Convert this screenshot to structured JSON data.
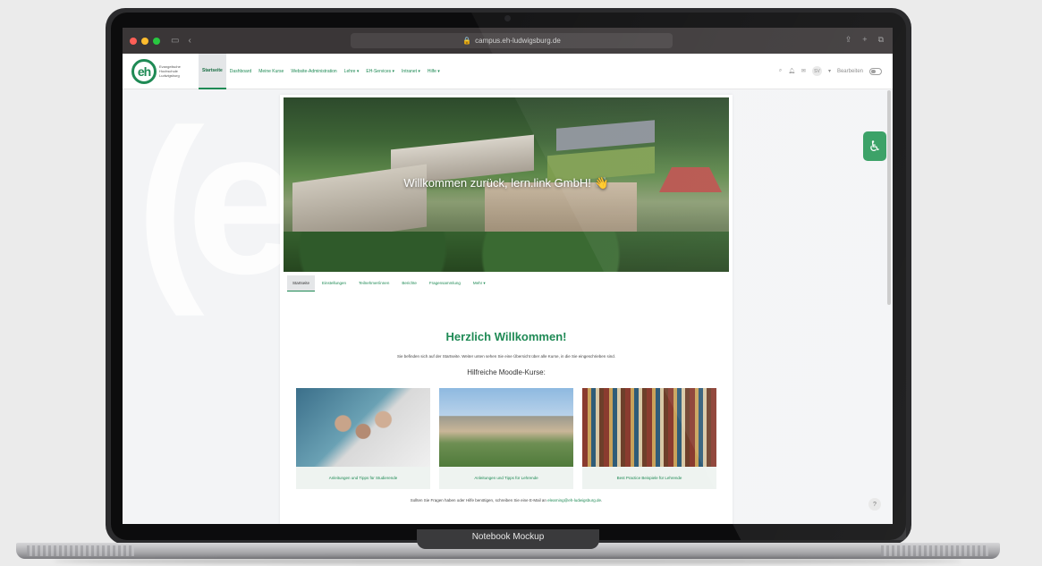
{
  "mockup": {
    "label": "Notebook Mockup"
  },
  "browser": {
    "url": "campus.eh-ludwigsburg.de"
  },
  "site_nav": {
    "logo_mark": "eh",
    "logo_text": "Evangelische Hochschule Ludwigsburg",
    "items": [
      {
        "label": "Startseite"
      },
      {
        "label": "Dashboard"
      },
      {
        "label": "Meine Kurse"
      },
      {
        "label": "Website-Administration"
      },
      {
        "label": "Lehre ▾"
      },
      {
        "label": "EH-Services ▾"
      },
      {
        "label": "Intranet ▾"
      },
      {
        "label": "Hilfe ▾"
      }
    ],
    "avatar": "SV",
    "edit_mode": "Bearbeiten"
  },
  "hero": {
    "title": "Willkommen zurück, lern.link GmbH! 👋"
  },
  "tabs": [
    {
      "label": "Startseite"
    },
    {
      "label": "Einstellungen"
    },
    {
      "label": "Teilnehmer/innen"
    },
    {
      "label": "Berichte"
    },
    {
      "label": "Fragensammlung"
    },
    {
      "label": "Mehr ▾"
    }
  ],
  "main": {
    "welcome_heading": "Herzlich Willkommen!",
    "intro_text": "Sie befinden sich auf der Startseite. Weiter unten sehen Sie eine Übersicht über alle Kurse, in die Sie eingeschrieben sind.",
    "courses_heading": "Hilfreiche Moodle-Kurse:",
    "courses": [
      {
        "caption": "Anleitungen und Tipps für Studierende"
      },
      {
        "caption": "Anleitungen und Tipps für Lehrende"
      },
      {
        "caption": "Best Practice Beispiele für Lehrende"
      }
    ],
    "footer_text": "Sollten Sie Fragen haben oder Hilfe benötigen, schreiben Sie eine E-Mail an",
    "footer_email": "elearning@eh-ludwigsburg.de"
  },
  "accessibility_icon": "accessibility-icon",
  "help_icon": "help-icon"
}
